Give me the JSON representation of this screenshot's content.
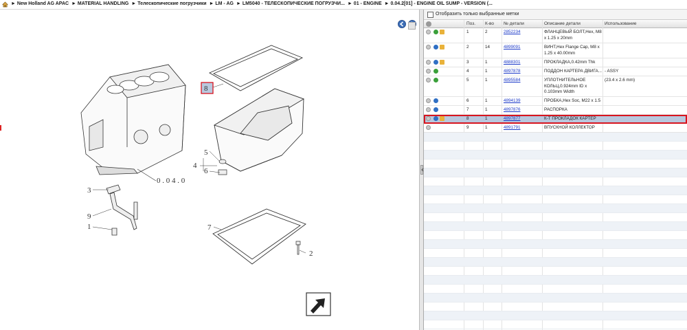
{
  "breadcrumb": [
    "► New Holland AG APAC",
    "► MATERIAL HANDLING",
    "► Телескопические погрузчики",
    "► LM - AG",
    "► LM5040 - ТЕЛЕСКОПИЧЕСКИЕ ПОГРУЗЧИ...",
    "► 01 - ENGINE",
    "► 0.04.2[01] - ENGINE OIL SUMP - VERSION (..."
  ],
  "diagram": {
    "callouts": [
      "8",
      "5",
      "4",
      "6",
      "3",
      "9",
      "1",
      "7",
      "2"
    ],
    "ref_label": "0 . 0 4 . 0"
  },
  "filter_label": "Отобразить только выбранные метки",
  "columns": {
    "pos": "Поз.",
    "qty": "К-во",
    "part": "№ детали",
    "desc": "Описание детали",
    "usage": "Использование"
  },
  "parts": [
    {
      "pos": "1",
      "qty": "2",
      "part": "2852234",
      "desc": "ФЛАНЦЕВЫЙ БОЛТ,Hex, M8 x 1.25 x 20mm",
      "usage": "",
      "icons": [
        "green",
        "yellow"
      ],
      "sel": false
    },
    {
      "pos": "2",
      "qty": "14",
      "part": "4899091",
      "desc": "ВИНТ,Hex Flange Cap, M8 x 1.25 x 40.00mm",
      "usage": "",
      "icons": [
        "blue",
        "yellow"
      ],
      "sel": false
    },
    {
      "pos": "3",
      "qty": "1",
      "part": "4888301",
      "desc": "ПРОКЛАДКА,0.42mm Thk",
      "usage": "",
      "icons": [
        "blue",
        "yellow"
      ],
      "sel": false
    },
    {
      "pos": "4",
      "qty": "1",
      "part": "4897878",
      "desc": "ПОДДОН КАРТЕРА ДВИГА...",
      "usage": "- ASSY",
      "icons": [
        "green"
      ],
      "sel": false
    },
    {
      "pos": "5",
      "qty": "1",
      "part": "4895584",
      "desc": "УПЛОТНИТЕЛЬНОЕ КОЛЬЦ,0.924mm ID x 0.103mm Width",
      "usage": "(23.4 x 2.6 mm)",
      "icons": [
        "green"
      ],
      "sel": false
    },
    {
      "pos": "6",
      "qty": "1",
      "part": "4894139",
      "desc": "ПРОБКА,Hex Soc, M22 x 1.5",
      "usage": "",
      "icons": [
        "blue"
      ],
      "sel": false
    },
    {
      "pos": "7",
      "qty": "1",
      "part": "4897876",
      "desc": "РАСПОРКА",
      "usage": "",
      "icons": [
        "blue"
      ],
      "sel": false
    },
    {
      "pos": "8",
      "qty": "1",
      "part": "4897877",
      "desc": "К-Т ПРОКЛАДОК КАРТЕР",
      "usage": "",
      "icons": [
        "blue",
        "yellow"
      ],
      "sel": true
    },
    {
      "pos": "9",
      "qty": "1",
      "part": "4891791",
      "desc": "ВПУСКНОЙ КОЛЛЕКТОР",
      "usage": "",
      "icons": [],
      "sel": false
    }
  ],
  "colors": {
    "green": "#3aa03a",
    "blue": "#2f6fc4",
    "yellow": "#e9b23a",
    "select": "#b9c8de",
    "highlight": "#d8141e"
  }
}
